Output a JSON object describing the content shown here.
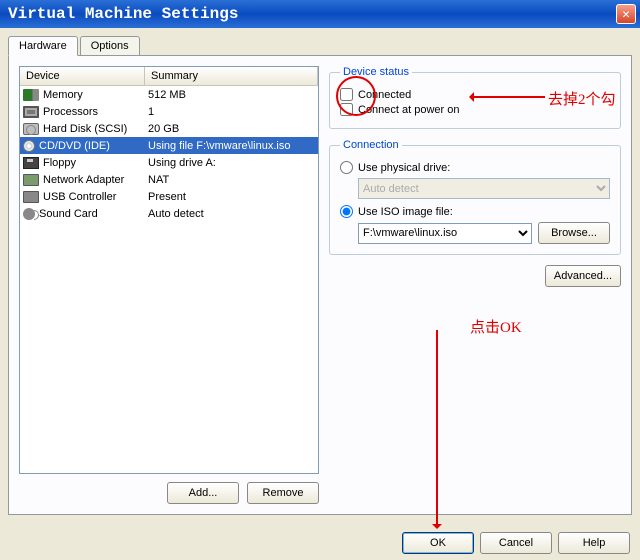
{
  "window": {
    "title": "Virtual Machine Settings",
    "close_label": "✕"
  },
  "tabs": {
    "hardware": "Hardware",
    "options": "Options"
  },
  "device_list": {
    "header_device": "Device",
    "header_summary": "Summary",
    "items": [
      {
        "name": "Memory",
        "summary": "512 MB"
      },
      {
        "name": "Processors",
        "summary": "1"
      },
      {
        "name": "Hard Disk (SCSI)",
        "summary": "20 GB"
      },
      {
        "name": "CD/DVD (IDE)",
        "summary": "Using file F:\\vmware\\linux.iso"
      },
      {
        "name": "Floppy",
        "summary": "Using drive A:"
      },
      {
        "name": "Network Adapter",
        "summary": "NAT"
      },
      {
        "name": "USB Controller",
        "summary": "Present"
      },
      {
        "name": "Sound Card",
        "summary": "Auto detect"
      }
    ],
    "selected_index": 3
  },
  "left_buttons": {
    "add": "Add...",
    "remove": "Remove"
  },
  "device_status": {
    "legend": "Device status",
    "connected": "Connected",
    "connect_power_on": "Connect at power on",
    "connected_checked": false,
    "power_on_checked": false
  },
  "connection": {
    "legend": "Connection",
    "use_physical": "Use physical drive:",
    "physical_value": "Auto detect",
    "use_iso": "Use ISO image file:",
    "iso_value": "F:\\vmware\\linux.iso",
    "browse": "Browse...",
    "selected": "iso"
  },
  "advanced": "Advanced...",
  "bottom": {
    "ok": "OK",
    "cancel": "Cancel",
    "help": "Help"
  },
  "annotations": {
    "uncheck_text": "去掉2个勾",
    "click_ok_text": "点击OK"
  }
}
